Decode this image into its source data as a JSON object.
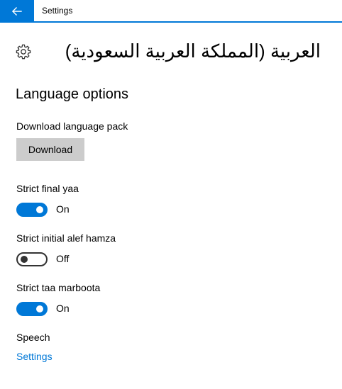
{
  "window": {
    "title": "Settings",
    "accent_color": "#0078d7",
    "back_icon": "back-arrow-icon"
  },
  "page": {
    "icon": "gear-icon",
    "title": "العربية (المملكة العربية السعودية)"
  },
  "section": {
    "title": "Language options"
  },
  "download": {
    "label": "Download language pack",
    "button_label": "Download"
  },
  "toggles": [
    {
      "label": "Strict final yaa",
      "state": "On",
      "on": true
    },
    {
      "label": "Strict initial alef hamza",
      "state": "Off",
      "on": false
    },
    {
      "label": "Strict taa marboota",
      "state": "On",
      "on": true
    }
  ],
  "speech": {
    "label": "Speech",
    "link": "Settings"
  }
}
